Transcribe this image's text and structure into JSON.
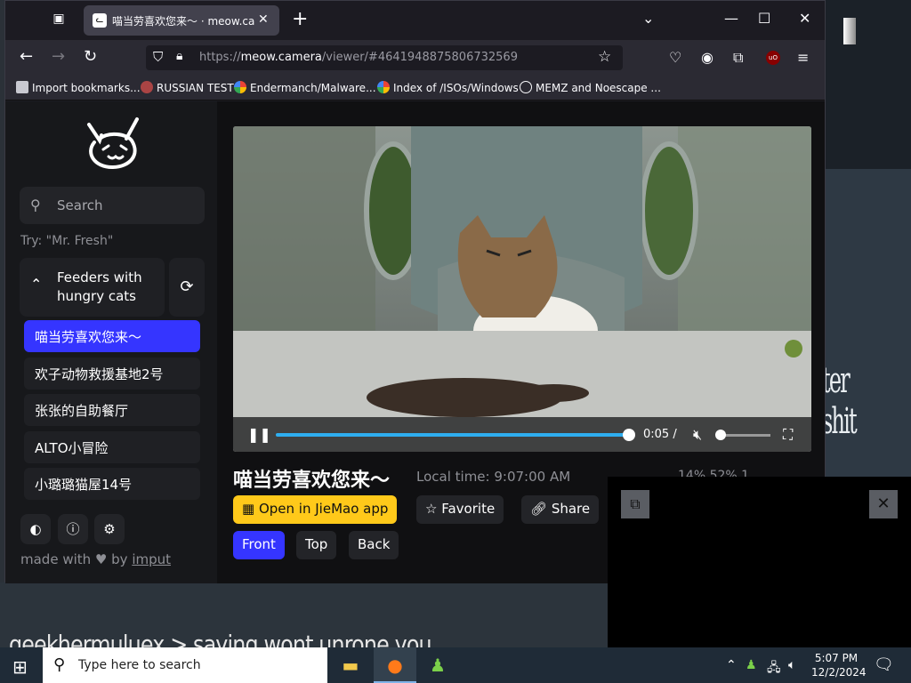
{
  "browser": {
    "tab_title": "喵当劳喜欢您来～ · meow.camera",
    "url_prefix": "https://",
    "url_domain": "meow.camera",
    "url_path": "/viewer/#4641948875806732569",
    "bookmarks": [
      "Import bookmarks...",
      "RUSSIAN TEST",
      "Endermanch/Malware...",
      "Index of /ISOs/Windows",
      "MEMZ and Noescape ..."
    ]
  },
  "sidebar": {
    "search_placeholder": "Search",
    "try_hint": "Try: \"Mr. Fresh\"",
    "group_label": "Feeders with hungry cats",
    "cameras": [
      "喵当劳喜欢您来～",
      "欢子动物救援基地2号",
      "张张的自助餐厅",
      "ALTO小冒险",
      "小璐璐猫屋14号"
    ],
    "made_with": "made with ♥ by",
    "made_by": "imput"
  },
  "player": {
    "time": "0:05 /",
    "progress": 1.0
  },
  "camera": {
    "title": "喵当劳喜欢您来～",
    "local_time": "Local time: 9:07:00 AM",
    "stats": "14%  52%  1",
    "open_app": "Open in JieMao app",
    "favorite": "Favorite",
    "share": "Share",
    "views": [
      "Front",
      "Top",
      "Back"
    ]
  },
  "desktop": {
    "scribble_right": "ter shit",
    "scribble_bottom": "geekhermuluex > saying wont unrone you"
  },
  "taskbar": {
    "search_placeholder": "Type here to search",
    "time": "5:07 PM",
    "date": "12/2/2024"
  },
  "colors": {
    "accent_blue": "#3535ff",
    "accent_yellow": "#ffc91a",
    "seek_blue": "#2eaef0"
  }
}
